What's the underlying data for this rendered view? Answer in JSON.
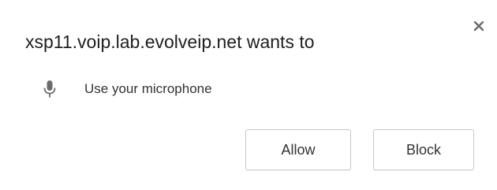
{
  "dialog": {
    "title": "xsp11.voip.lab.evolveip.net wants to",
    "close_icon": "close-icon",
    "permission": {
      "icon": "microphone-icon",
      "label": "Use your microphone"
    },
    "buttons": {
      "allow_label": "Allow",
      "block_label": "Block"
    }
  },
  "colors": {
    "background": "#ffffff",
    "text": "#1f1f1f",
    "icon": "#6b6b6b",
    "button_border": "#c8c8c8"
  }
}
